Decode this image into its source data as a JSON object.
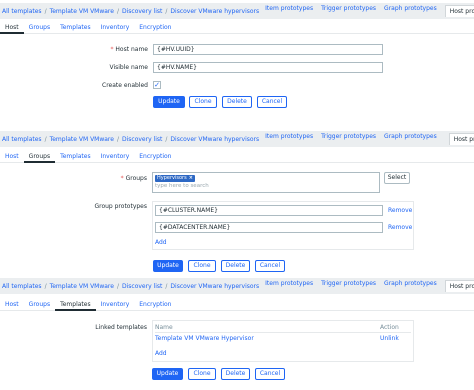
{
  "breadcrumb": [
    "All templates",
    "Template VM VMware",
    "Discovery list",
    "Discover VMware hypervisors"
  ],
  "breadcrumb_tabs": [
    "Item prototypes",
    "Trigger prototypes",
    "Graph prototypes",
    "Host prototypes"
  ],
  "breadcrumb_sep": "/",
  "form_tabs": [
    "Host",
    "Groups",
    "Templates",
    "Inventory",
    "Encryption"
  ],
  "host_panel": {
    "host_name_label": "Host name",
    "host_name_value": "{#HV.UUID}",
    "visible_name_label": "Visible name",
    "visible_name_value": "{#HV.NAME}",
    "create_enabled_label": "Create enabled",
    "create_enabled_mark": "✓"
  },
  "groups_panel": {
    "groups_label": "Groups",
    "selected_group": "Hypervisors",
    "remove_chip": "×",
    "placeholder": "type here to search",
    "select_button": "Select",
    "group_prototypes_label": "Group prototypes",
    "prototypes": [
      "{#CLUSTER.NAME}",
      "{#DATACENTER.NAME}"
    ],
    "remove_label": "Remove",
    "add_label": "Add"
  },
  "templates_panel": {
    "linked_templates_label": "Linked templates",
    "col_name": "Name",
    "col_action": "Action",
    "template_name": "Template VM VMware Hypervisor",
    "unlink_label": "Unlink",
    "add_label": "Add"
  },
  "buttons": {
    "update": "Update",
    "clone": "Clone",
    "delete": "Delete",
    "cancel": "Cancel"
  },
  "required_mark": "*",
  "colors": {
    "accent": "#1f65f4",
    "breadcrumb_bg": "#ebeef0",
    "chip": "#2d68c4",
    "required": "#e45959"
  }
}
